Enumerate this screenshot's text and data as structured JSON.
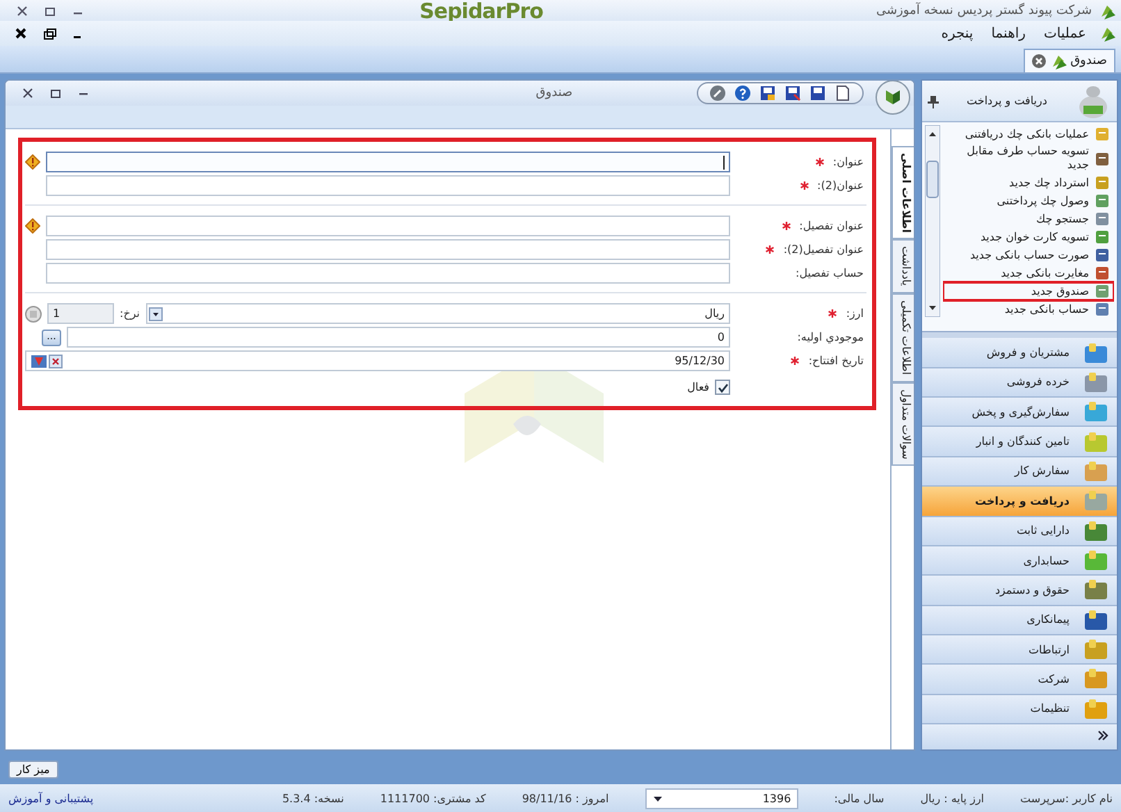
{
  "app": {
    "title": "شرکت پیوند گستر پردیس نسخه آموزشی",
    "logo": "SepidarPro"
  },
  "menu": [
    {
      "label": "عملیات"
    },
    {
      "label": "راهنما"
    },
    {
      "label": "پنجره"
    }
  ],
  "doc_tabs": [
    {
      "label": "صندوق",
      "selected": true
    }
  ],
  "document": {
    "title": "صندوق",
    "side_tabs": [
      {
        "label": "اطلاعات اصلی",
        "selected": true
      },
      {
        "label": "یادداشت",
        "selected": false
      },
      {
        "label": "اطلاعات تکمیلی",
        "selected": false
      },
      {
        "label": "سوالات متداول",
        "selected": false
      }
    ],
    "groups": [
      [
        {
          "kind": "text",
          "label": "عنوان:",
          "required": true,
          "warning": true,
          "focused": true
        },
        {
          "kind": "text",
          "label": "عنوان(2):",
          "required": true,
          "warning": false,
          "focused": false
        }
      ],
      [
        {
          "kind": "text",
          "label": "عنوان تفصیل:",
          "required": true,
          "warning": true,
          "focused": false
        },
        {
          "kind": "text",
          "label": "عنوان تفصیل(2):",
          "required": true,
          "warning": false,
          "focused": false
        },
        {
          "kind": "text",
          "label": "حساب تفصیل:",
          "required": false,
          "warning": false,
          "focused": false
        }
      ],
      [
        {
          "kind": "currency",
          "label": "ارز:",
          "required": true,
          "value": "ریال",
          "rate_label": "نرخ:",
          "rate": "1"
        },
        {
          "kind": "browse",
          "label": "موجودي اولیه:",
          "required": false,
          "value": "0",
          "button": "..."
        },
        {
          "kind": "date",
          "label": "تاریخ افتتاح:",
          "required": true,
          "value": "95/12/30"
        }
      ]
    ],
    "active": {
      "label": "فعال",
      "checked": true
    }
  },
  "sidebar": {
    "title": "دریافت و پرداخت",
    "items": [
      {
        "label": "عملیات بانکی چك دریافتنی",
        "selected": false
      },
      {
        "label": "تسویه حساب طرف مقابل جدید",
        "selected": false
      },
      {
        "label": "استرداد چك جدید",
        "selected": false
      },
      {
        "label": "وصول چك پرداختنی",
        "selected": false
      },
      {
        "label": "جستجو چك",
        "selected": false
      },
      {
        "label": "تسویه کارت خوان جدید",
        "selected": false
      },
      {
        "label": "صورت حساب بانکی جدید",
        "selected": false
      },
      {
        "label": "مغایرت بانکی جدید",
        "selected": false
      },
      {
        "label": "صندوق جدید",
        "selected": true
      },
      {
        "label": "حساب بانکی جدید",
        "selected": false
      }
    ],
    "modules": [
      {
        "label": "مشتریان و فروش",
        "selected": false,
        "color": "#3a8ad8"
      },
      {
        "label": "خرده فروشی",
        "selected": false,
        "color": "#8a96a8"
      },
      {
        "label": "سفارش‌گیری و پخش",
        "selected": false,
        "color": "#38a8d8"
      },
      {
        "label": "تامین کنندگان و انبار",
        "selected": false,
        "color": "#b8c830"
      },
      {
        "label": "سفارش کار",
        "selected": false,
        "color": "#d8a050"
      },
      {
        "label": "دریافت و پرداخت",
        "selected": true,
        "color": "#98a8a0"
      },
      {
        "label": "دارایی ثابت",
        "selected": false,
        "color": "#488838"
      },
      {
        "label": "حسابداری",
        "selected": false,
        "color": "#58b838"
      },
      {
        "label": "حقوق و دستمزد",
        "selected": false,
        "color": "#788048"
      },
      {
        "label": "پیمانکاری",
        "selected": false,
        "color": "#2858a8"
      },
      {
        "label": "ارتباطات",
        "selected": false,
        "color": "#c8a020"
      },
      {
        "label": "شرکت",
        "selected": false,
        "color": "#d89820"
      },
      {
        "label": "تنظیمات",
        "selected": false,
        "color": "#e0a010"
      }
    ]
  },
  "desktop_button": "میز کار",
  "status": {
    "user": "نام کاربر :سرپرست",
    "base_currency": "ارز پایه :  ریال",
    "fiscal_year_label": "سال مالی:",
    "fiscal_year": "1396",
    "today": "امروز :  98/11/16",
    "customer_code": "کد مشتری:  1111700",
    "version": "نسخه:  5.3.4",
    "support": "پشتیبانی و آموزش"
  }
}
